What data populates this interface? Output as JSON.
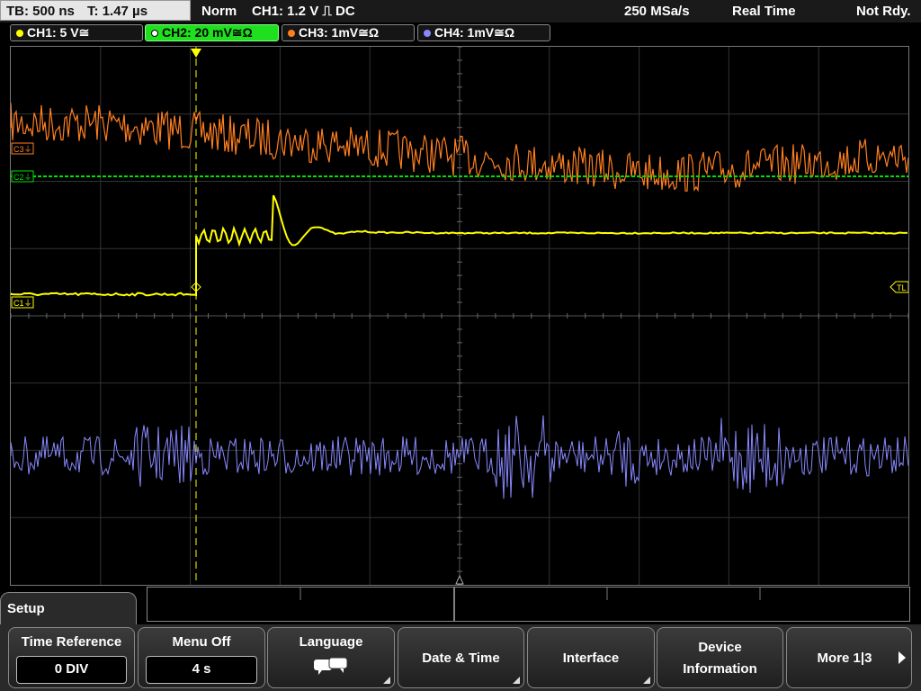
{
  "status_bar": {
    "timebase": "TB: 500 ns",
    "time_pos": "T: 1.47 µs",
    "mode": "Norm",
    "trigger": "CH1: 1.2 V ⎍ DC",
    "sample_rate": "250 MSa/s",
    "acquisition": "Real Time",
    "status": "Not Rdy."
  },
  "channels": [
    {
      "label": "CH1: 5 V≅",
      "color": "#ffff00"
    },
    {
      "label": "CH2: 20 mV≅Ω",
      "color": "#00ff00"
    },
    {
      "label": "CH3: 1mV≅Ω",
      "color": "#ff7f1f"
    },
    {
      "label": "CH4: 1mV≅Ω",
      "color": "#8888ff"
    }
  ],
  "markers": {
    "c3": "C3⏚",
    "c2": "C2⏚",
    "c1": "C1⏚",
    "trigger_level": "TL",
    "trigger_pos": "T"
  },
  "menu": {
    "title": "Setup",
    "softkeys": [
      {
        "label": "Time Reference",
        "value": "0 DIV"
      },
      {
        "label": "Menu Off",
        "value": "4 s"
      },
      {
        "label": "Language",
        "icon": "speech-bubble-icon"
      },
      {
        "label": "Date & Time"
      },
      {
        "label": "Interface"
      },
      {
        "label": "Device Information",
        "line1": "Device",
        "line2": "Information"
      },
      {
        "label": "More 1|3"
      }
    ]
  },
  "colors": {
    "ch1": "#ffff00",
    "ch2": "#00ff00",
    "ch3": "#ff7f1f",
    "ch4": "#8888ff",
    "grid": "#444444"
  }
}
